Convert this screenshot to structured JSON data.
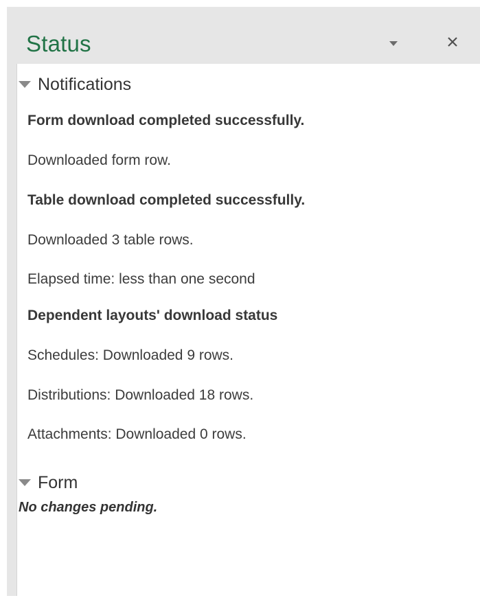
{
  "pane": {
    "title": "Status",
    "title_color": "#217346",
    "menu_icon": "chevron-down-icon",
    "close_icon": "close-icon"
  },
  "notifications": {
    "label": "Notifications",
    "lines": [
      {
        "text": "Form download completed successfully.",
        "bold": true
      },
      {
        "text": "Downloaded form row.",
        "bold": false
      },
      {
        "text": "Table download completed successfully.",
        "bold": true
      },
      {
        "text": "Downloaded 3 table rows.",
        "bold": false
      },
      {
        "text": "Elapsed time: less than one second",
        "bold": false
      },
      {
        "text": "Dependent layouts' download status",
        "bold": true
      },
      {
        "text": "Schedules: Downloaded 9 rows.",
        "bold": false
      },
      {
        "text": "Distributions: Downloaded 18 rows.",
        "bold": false
      },
      {
        "text": "Attachments: Downloaded 0 rows.",
        "bold": false
      }
    ]
  },
  "form": {
    "label": "Form",
    "pending": "No changes pending."
  }
}
